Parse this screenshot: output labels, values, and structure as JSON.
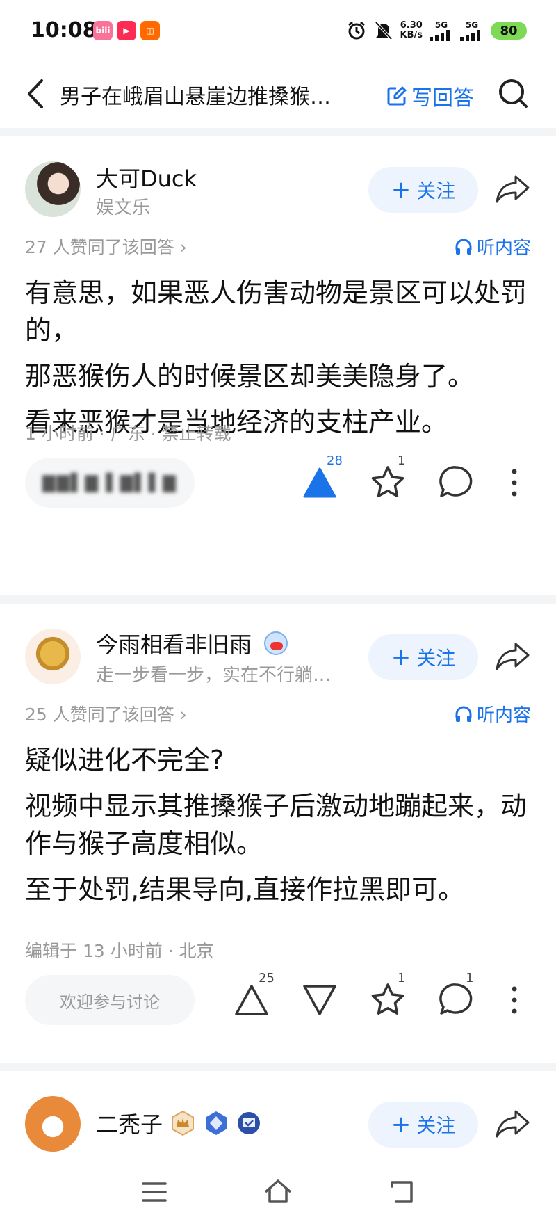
{
  "status_bar": {
    "time": "10:08",
    "speed_value": "6.30",
    "speed_unit": "KB/s",
    "signal_1": "5G",
    "signal_2": "5G",
    "battery": "80"
  },
  "header": {
    "title": "男子在峨眉山悬崖边推搡猴…",
    "write_answer": "写回答"
  },
  "answers": [
    {
      "author": "大可Duck",
      "subtitle": "娱文乐",
      "follow_label": "关注",
      "agree_text": "27 人赞同了该回答 ›",
      "listen_label": "听内容",
      "paragraphs": [
        "有意思，如果恶人伤害动物是景区可以处罚的，",
        "那恶猴伤人的时候景区却美美隐身了。",
        "看来恶猴才是当地经济的支柱产业。"
      ],
      "meta": "1 小时前 · 广东 · 禁止转载",
      "comment_placeholder": "▇▇▌▇ ▌▇▌▌▇",
      "upvotes": "28",
      "favorites": "1"
    },
    {
      "author": "今雨相看非旧雨",
      "subtitle": "走一步看一步，实在不行躺…",
      "follow_label": "关注",
      "agree_text": "25 人赞同了该回答 ›",
      "listen_label": "听内容",
      "paragraphs": [
        "疑似进化不完全?",
        "视频中显示其推搡猴子后激动地蹦起来，动作与猴子高度相似。",
        "至于处罚,结果导向,直接作拉黑即可。"
      ],
      "meta": "编辑于 13 小时前 · 北京",
      "comment_placeholder": "欢迎参与讨论",
      "upvotes": "25",
      "favorites": "1",
      "comments": "1"
    },
    {
      "author": "二秃子",
      "follow_label": "关注"
    }
  ],
  "colors": {
    "accent": "#1a73e8",
    "battery": "#7ed957",
    "muted": "#999999"
  }
}
